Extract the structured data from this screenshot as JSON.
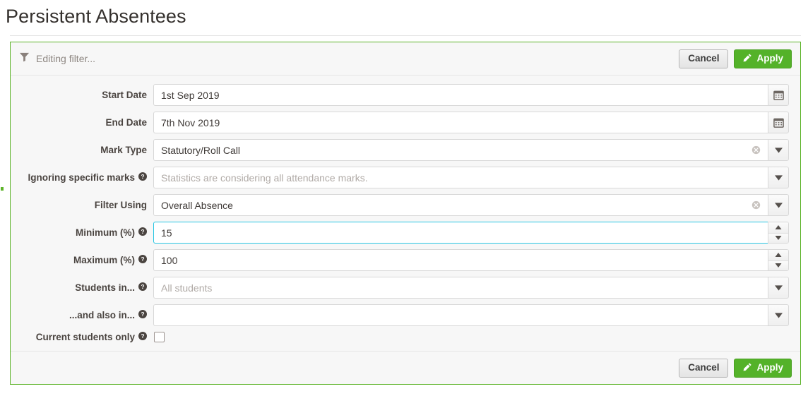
{
  "page": {
    "title": "Persistent Absentees"
  },
  "filter_panel": {
    "header": {
      "icon": "filter-funnel-icon",
      "status_text": "Editing filter...",
      "cancel_label": "Cancel",
      "apply_label": "Apply",
      "apply_icon": "pencil-icon"
    },
    "footer": {
      "cancel_label": "Cancel",
      "apply_label": "Apply",
      "apply_icon": "pencil-icon"
    },
    "fields": [
      {
        "label": "Start Date",
        "has_help": false,
        "value": "1st Sep 2019",
        "placeholder": "",
        "control": "date",
        "addon_icon": "calendar-icon",
        "focused": false
      },
      {
        "label": "End Date",
        "has_help": false,
        "value": "7th Nov 2019",
        "placeholder": "",
        "control": "date",
        "addon_icon": "calendar-icon",
        "focused": false
      },
      {
        "label": "Mark Type",
        "has_help": false,
        "value": "Statutory/Roll Call",
        "placeholder": "",
        "control": "select",
        "addon_icon": "chevron-down-icon",
        "clearable": true,
        "focused": false
      },
      {
        "label": "Ignoring specific marks",
        "has_help": true,
        "value": "",
        "placeholder": "Statistics are considering all attendance marks.",
        "control": "select",
        "addon_icon": "chevron-down-icon",
        "clearable": false,
        "focused": false
      },
      {
        "label": "Filter Using",
        "has_help": false,
        "value": "Overall Absence",
        "placeholder": "",
        "control": "select",
        "addon_icon": "chevron-down-icon",
        "clearable": true,
        "focused": false
      },
      {
        "label": "Minimum (%)",
        "has_help": true,
        "value": "15",
        "placeholder": "",
        "control": "number",
        "addon_icon": "spinner-icon",
        "focused": true
      },
      {
        "label": "Maximum (%)",
        "has_help": true,
        "value": "100",
        "placeholder": "",
        "control": "number",
        "addon_icon": "spinner-icon",
        "focused": false
      },
      {
        "label": "Students in...",
        "has_help": true,
        "value": "",
        "placeholder": "All students",
        "control": "select",
        "addon_icon": "chevron-down-icon",
        "clearable": false,
        "focused": false
      },
      {
        "label": "...and also in...",
        "has_help": true,
        "value": "",
        "placeholder": "",
        "control": "select",
        "addon_icon": "chevron-down-icon",
        "clearable": false,
        "focused": false
      },
      {
        "label": "Current students only",
        "has_help": true,
        "value": "",
        "placeholder": "",
        "control": "checkbox",
        "checked": false,
        "focused": false
      }
    ]
  },
  "colors": {
    "accent_green": "#54b229",
    "panel_border_green": "#5cb328",
    "focus_cyan": "#28c6e2",
    "label_text": "#4a4440",
    "placeholder_text": "#b0aaa6",
    "panel_bg": "#f7f7f7"
  }
}
